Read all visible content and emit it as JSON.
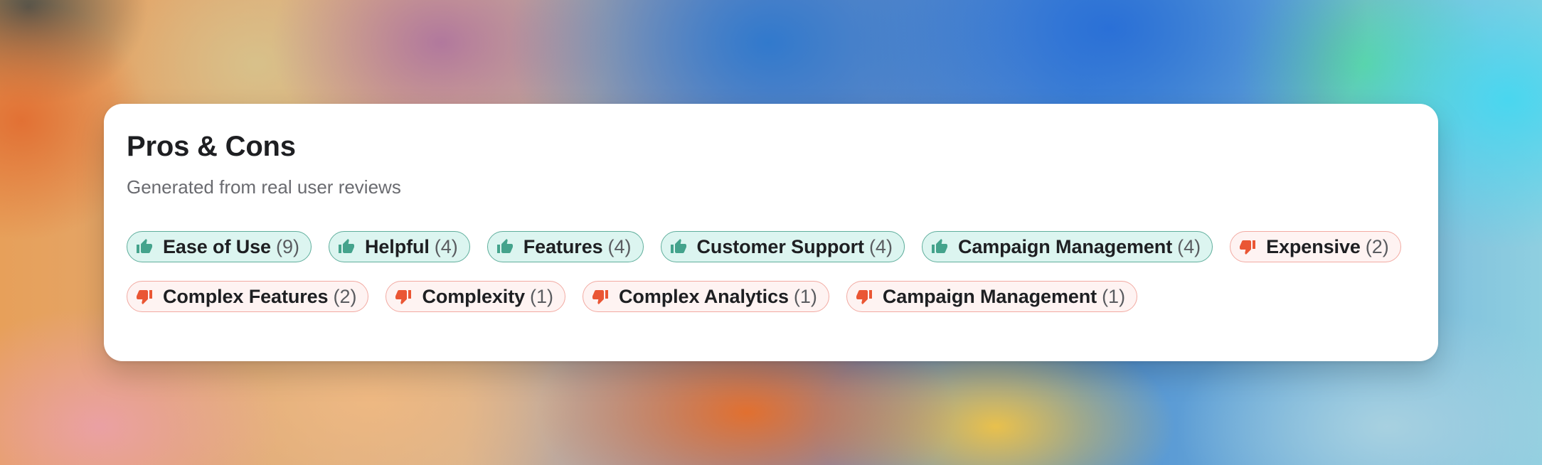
{
  "card": {
    "title": "Pros & Cons",
    "subtitle": "Generated from real user reviews"
  },
  "colors": {
    "pro_background": "#dcf5f0",
    "pro_border": "#5fae9c",
    "pro_icon": "#44a38c",
    "con_background": "#fef3f2",
    "con_border": "#f2aaa2",
    "con_icon": "#ea5634"
  },
  "icons": {
    "pro": "thumbs-up-icon",
    "con": "thumbs-down-icon"
  },
  "pros": [
    {
      "label": "Ease of Use",
      "count": "(9)"
    },
    {
      "label": "Helpful",
      "count": "(4)"
    },
    {
      "label": "Features",
      "count": "(4)"
    },
    {
      "label": "Customer Support",
      "count": "(4)"
    },
    {
      "label": "Campaign Management",
      "count": "(4)"
    }
  ],
  "cons": [
    {
      "label": "Expensive",
      "count": "(2)"
    },
    {
      "label": "Complex Features",
      "count": "(2)"
    },
    {
      "label": "Complexity",
      "count": "(1)"
    },
    {
      "label": "Complex Analytics",
      "count": "(1)"
    },
    {
      "label": "Campaign Management",
      "count": "(1)"
    }
  ]
}
